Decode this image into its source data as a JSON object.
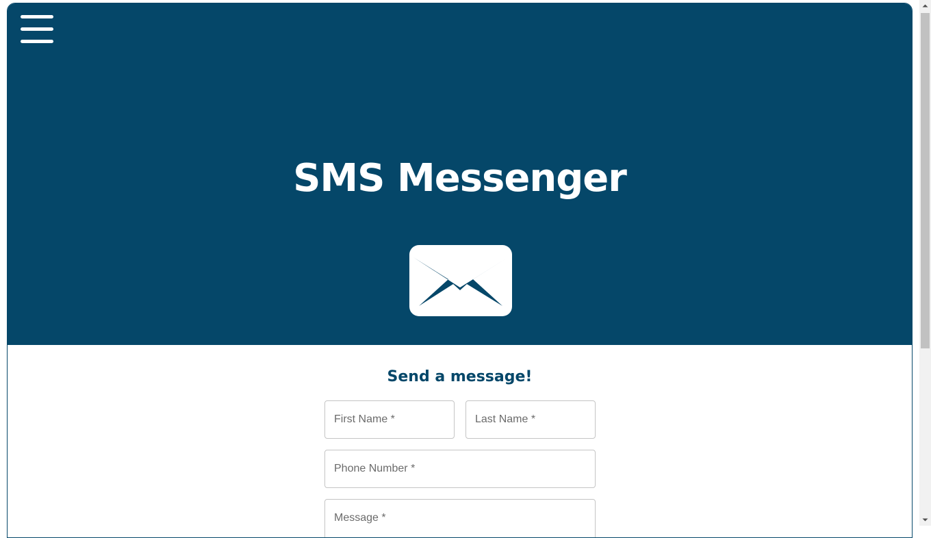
{
  "header": {
    "title": "SMS Messenger",
    "menu_icon": "hamburger-menu-icon",
    "envelope_icon": "envelope-icon",
    "background_color": "#054769"
  },
  "form": {
    "heading": "Send a message!",
    "first_name_placeholder": "First Name *",
    "last_name_placeholder": "Last Name *",
    "phone_placeholder": "Phone Number *",
    "message_placeholder": "Message *"
  },
  "scrollbar": {
    "up_icon": "scroll-up-arrow-icon",
    "down_icon": "scroll-down-arrow-icon"
  }
}
